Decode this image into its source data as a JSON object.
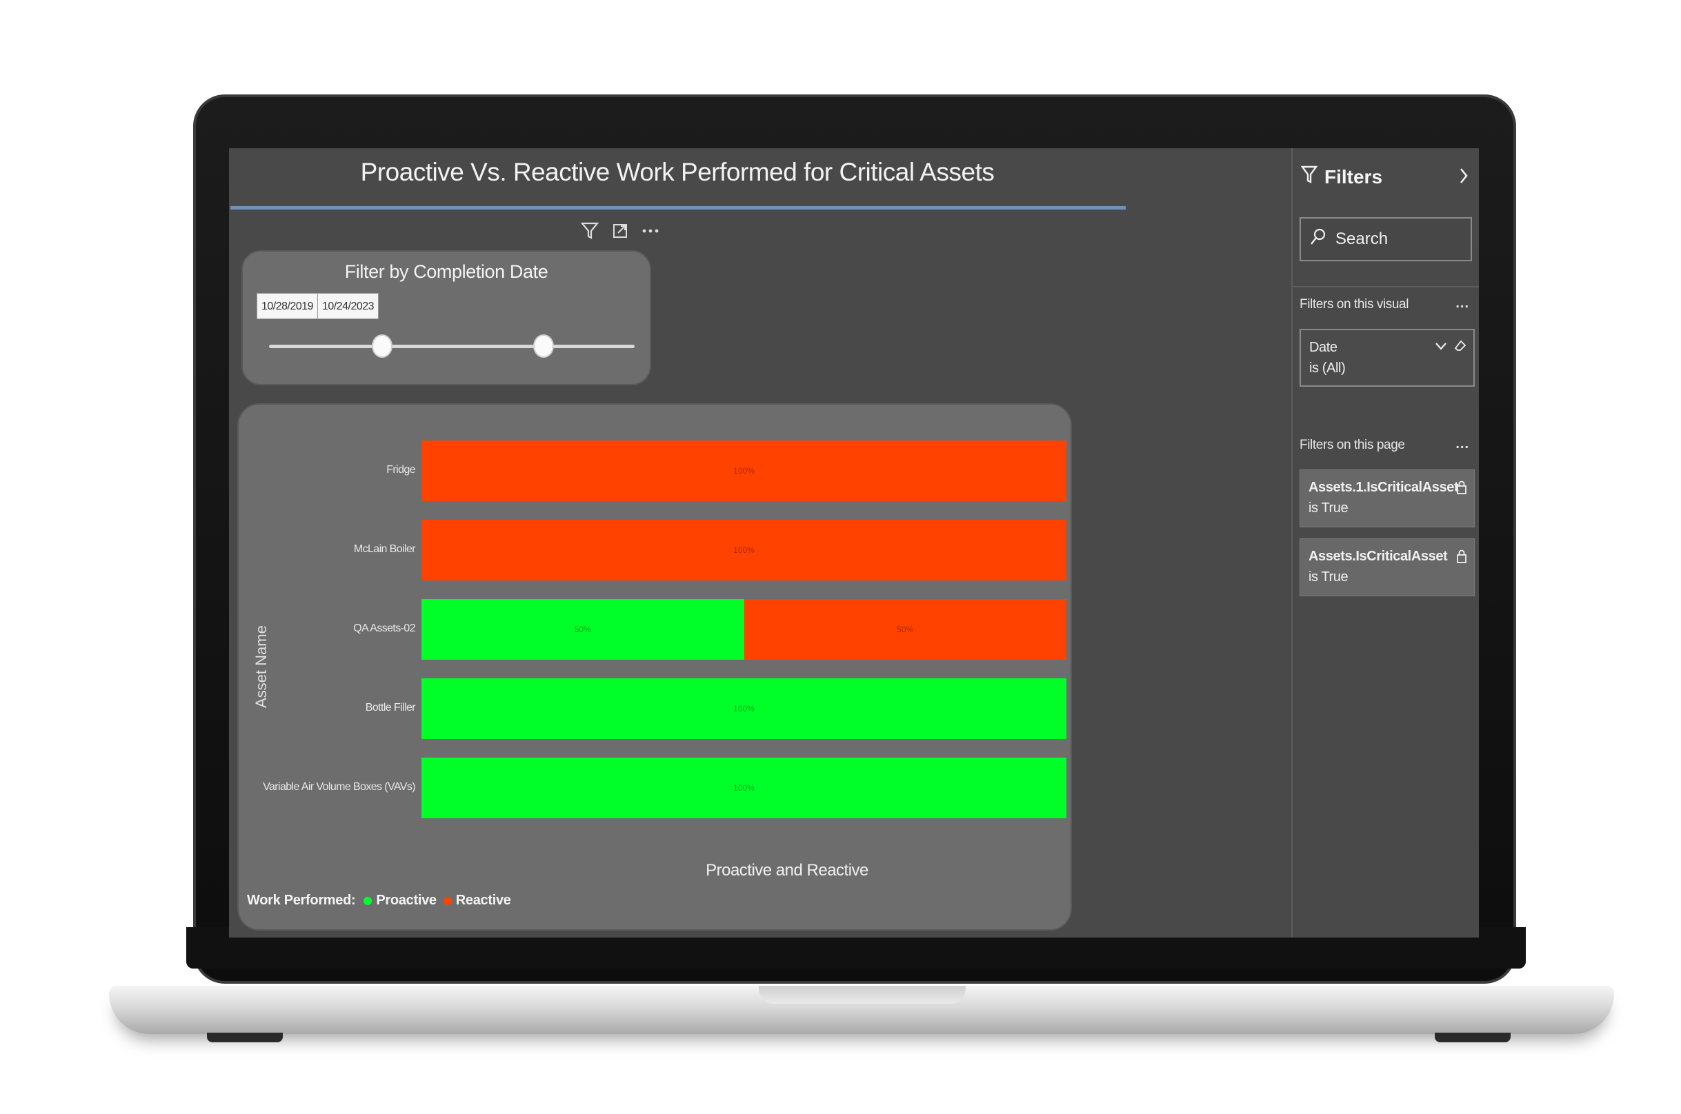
{
  "report": {
    "title": "Proactive Vs. Reactive Work Performed for Critical Assets"
  },
  "visual_header": {
    "icons": [
      "filter-icon",
      "focus-mode-icon",
      "more-options-icon"
    ]
  },
  "slicer": {
    "title": "Filter by Completion Date",
    "start_date": "10/28/2019",
    "end_date": "10/24/2023",
    "range_fraction": [
      0.31,
      0.75
    ]
  },
  "chart": {
    "y_axis_title": "Asset Name",
    "x_axis_title": "Proactive and Reactive",
    "legend_title": "Work Performed:",
    "legend_items": [
      "Proactive",
      "Reactive"
    ]
  },
  "chart_data": {
    "type": "bar",
    "orientation": "horizontal",
    "stacked": "100%",
    "categories": [
      "Fridge",
      "McLain Boiler",
      "QA Assets-02",
      "Bottle Filler",
      "Variable Air Volume Boxes (VAVs)"
    ],
    "series": [
      {
        "name": "Proactive",
        "color": "#00ff29",
        "values": [
          0,
          0,
          50,
          100,
          100
        ],
        "labels": [
          "",
          "",
          "50%",
          "100%",
          "100%"
        ]
      },
      {
        "name": "Reactive",
        "color": "#ff4200",
        "values": [
          100,
          100,
          50,
          0,
          0
        ],
        "labels": [
          "100%",
          "100%",
          "50%",
          "",
          ""
        ]
      }
    ],
    "xlim": [
      0,
      100
    ],
    "ylabel": "Asset Name",
    "xlabel": "Proactive and Reactive",
    "legend": "bottom-left"
  },
  "filters": {
    "title": "Filters",
    "search_placeholder": "Search",
    "on_visual_title": "Filters on this visual",
    "on_page_title": "Filters on this page",
    "more_label": "...",
    "visual_filters": [
      {
        "name": "Date",
        "value": "is (All)"
      }
    ],
    "page_filters": [
      {
        "name": "Assets.1.IsCriticalAsset",
        "value": "is True"
      },
      {
        "name": "Assets.IsCriticalAsset",
        "value": "is True"
      }
    ]
  },
  "colors": {
    "proactive": "#00ff29",
    "reactive": "#ff4200",
    "accent_rule": "#6e93b8",
    "canvas": "#494949",
    "card": "#6d6d6d"
  }
}
